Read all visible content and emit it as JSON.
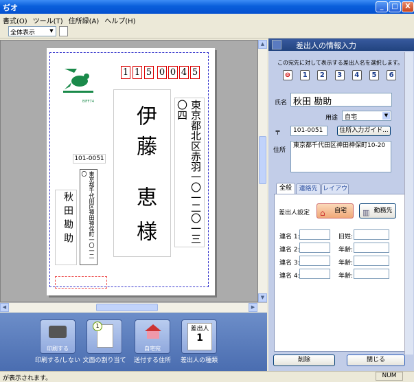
{
  "window": {
    "title": "ぢオ",
    "min": "_",
    "max": "□",
    "close": "X"
  },
  "menu": [
    "書式(O)",
    "ツール(T)",
    "住所録(A)",
    "ヘルプ(H)"
  ],
  "toolbar": {
    "view_combo": "全体表示"
  },
  "card": {
    "postal_digits": [
      "1",
      "1",
      "5",
      "0",
      "0",
      "4",
      "5"
    ],
    "stamp_code": "BIFF74",
    "recipient_address": "東京都北区赤羽一〇一二〇一三〇四",
    "recipient_name_1": "伊藤",
    "recipient_name_2": "恵",
    "honorific": "様",
    "sender_postal": "101-0051",
    "sender_address": "東京都千代田区神田神保町一〇一二〇",
    "sender_name": "秋田勘助"
  },
  "bottom_buttons": [
    {
      "top": "印刷する",
      "label": "印刷する/しない",
      "icon": "printer-icon"
    },
    {
      "top": "",
      "label": "文面の割り当て",
      "icon": "page-icon"
    },
    {
      "top": "自宅宛",
      "label": "送付する住所",
      "icon": "house-icon"
    },
    {
      "top": "差出人",
      "label": "差出人の種類",
      "icon": "sender-card-icon"
    }
  ],
  "panel": {
    "title": "差出人の情報入力",
    "instruction": "この宛先に対して表示する差出人名を選択します。",
    "sender_icons": [
      "1",
      "2",
      "3",
      "4",
      "5",
      "6"
    ],
    "name_label": "氏名",
    "name_value": "秋田 勘助",
    "usage_label": "用途",
    "usage_value": "自宅",
    "zip_label": "〒",
    "zip_value": "101-0051",
    "guide_button": "住所入力ガイド...",
    "address_label": "住所",
    "address_value": "東京都千代田区神田神保町10-20",
    "tabs": [
      "全般",
      "連絡先",
      "レイアウト"
    ],
    "sender_setting_label": "差出人設定",
    "home_button": "自宅",
    "work_button": "勤務先",
    "joint_labels": [
      "連名 1:",
      "連名 2:",
      "連名 3:",
      "連名 4:"
    ],
    "age_labels": [
      "旧姓:",
      "年齢:",
      "年齢:",
      "年齢:"
    ],
    "delete_button": "削除",
    "close_button": "閉じる"
  },
  "status": {
    "text": "が表示されます。",
    "num": "NUM"
  }
}
